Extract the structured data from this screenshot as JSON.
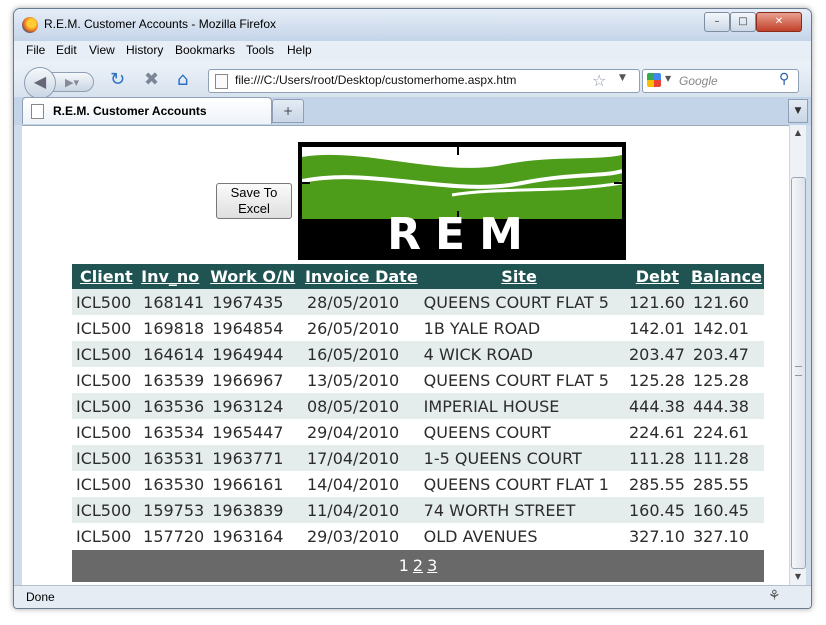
{
  "window": {
    "title": "R.E.M. Customer Accounts - Mozilla Firefox"
  },
  "menu": [
    "File",
    "Edit",
    "View",
    "History",
    "Bookmarks",
    "Tools",
    "Help"
  ],
  "address": {
    "url": "file:///C:/Users/root/Desktop/customerhome.aspx.htm"
  },
  "search": {
    "placeholder": "Google"
  },
  "tab": {
    "title": "R.E.M. Customer Accounts",
    "new_tab_symbol": "+"
  },
  "status": {
    "text": "Done"
  },
  "page": {
    "save_button_line1": "Save To",
    "save_button_line2": "Excel",
    "logo_text": "REM",
    "colors": {
      "header_bg": "#1f5452",
      "alt_row": "#e5ecec",
      "pager_bg": "#696969",
      "logo_green": "#4e9d1a"
    },
    "grid": {
      "headers": [
        "Client",
        "Inv_no",
        "Work O/N",
        "Invoice Date",
        "Site",
        "Debt",
        "Balance"
      ],
      "rows": [
        [
          "ICL500",
          "168141",
          "1967435",
          "28/05/2010",
          "QUEENS COURT FLAT 5",
          "121.60",
          "121.60"
        ],
        [
          "ICL500",
          "169818",
          "1964854",
          "26/05/2010",
          "1B YALE ROAD",
          "142.01",
          "142.01"
        ],
        [
          "ICL500",
          "164614",
          "1964944",
          "16/05/2010",
          "4 WICK ROAD",
          "203.47",
          "203.47"
        ],
        [
          "ICL500",
          "163539",
          "1966967",
          "13/05/2010",
          "QUEENS COURT FLAT 5",
          "125.28",
          "125.28"
        ],
        [
          "ICL500",
          "163536",
          "1963124",
          "08/05/2010",
          "IMPERIAL HOUSE",
          "444.38",
          "444.38"
        ],
        [
          "ICL500",
          "163534",
          "1965447",
          "29/04/2010",
          "QUEENS COURT",
          "224.61",
          "224.61"
        ],
        [
          "ICL500",
          "163531",
          "1963771",
          "17/04/2010",
          "1-5 QUEENS COURT",
          "111.28",
          "111.28"
        ],
        [
          "ICL500",
          "163530",
          "1966161",
          "14/04/2010",
          "QUEENS COURT FLAT 1",
          "285.55",
          "285.55"
        ],
        [
          "ICL500",
          "159753",
          "1963839",
          "11/04/2010",
          "74 WORTH STREET",
          "160.45",
          "160.45"
        ],
        [
          "ICL500",
          "157720",
          "1963164",
          "29/03/2010",
          "OLD AVENUES",
          "327.10",
          "327.10"
        ]
      ]
    },
    "pager": {
      "current": "1",
      "pages": [
        "2",
        "3"
      ]
    }
  }
}
